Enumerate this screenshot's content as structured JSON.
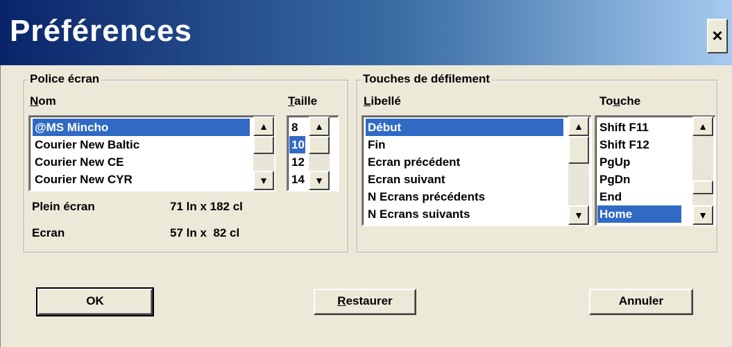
{
  "window": {
    "title": "Préférences",
    "close_label": "×"
  },
  "police": {
    "group_title": "Police écran",
    "nom_label": "Nom",
    "nom_hotkey": "N",
    "nom_rest": "om",
    "taille_label": "Taille",
    "taille_hotkey": "T",
    "taille_rest": "aille",
    "fonts": [
      "@MS Mincho",
      "Courier New Baltic",
      "Courier New CE",
      "Courier New CYR"
    ],
    "selected_font": "@MS Mincho",
    "sizes": [
      "8",
      "10",
      "12",
      "14"
    ],
    "selected_size": "10",
    "plein_ecran_label": "Plein écran",
    "plein_ecran_value": "71 ln x 182 cl",
    "ecran_label": "Ecran",
    "ecran_value": "57 ln x  82 cl"
  },
  "touches": {
    "group_title": "Touches de défilement",
    "libelle_label": "Libellé",
    "libelle_hotkey": "L",
    "libelle_rest": "ibellé",
    "touche_label": "Touche",
    "touche_pre": "To",
    "touche_hotkey": "u",
    "touche_rest": "che",
    "libelles": [
      "Début",
      "Fin",
      "Ecran précédent",
      "Ecran suivant",
      "N Ecrans précédents",
      "N Ecrans suivants"
    ],
    "selected_libelle": "Début",
    "keys": [
      "Shift F11",
      "Shift F12",
      "PgUp",
      "PgDn",
      "End",
      "Home"
    ],
    "selected_key": "Home"
  },
  "buttons": {
    "ok": "OK",
    "restaurer_hotkey": "R",
    "restaurer_rest": "estaurer",
    "annuler": "Annuler"
  },
  "icons": {
    "scroll_up": "▲",
    "scroll_down": "▼"
  }
}
